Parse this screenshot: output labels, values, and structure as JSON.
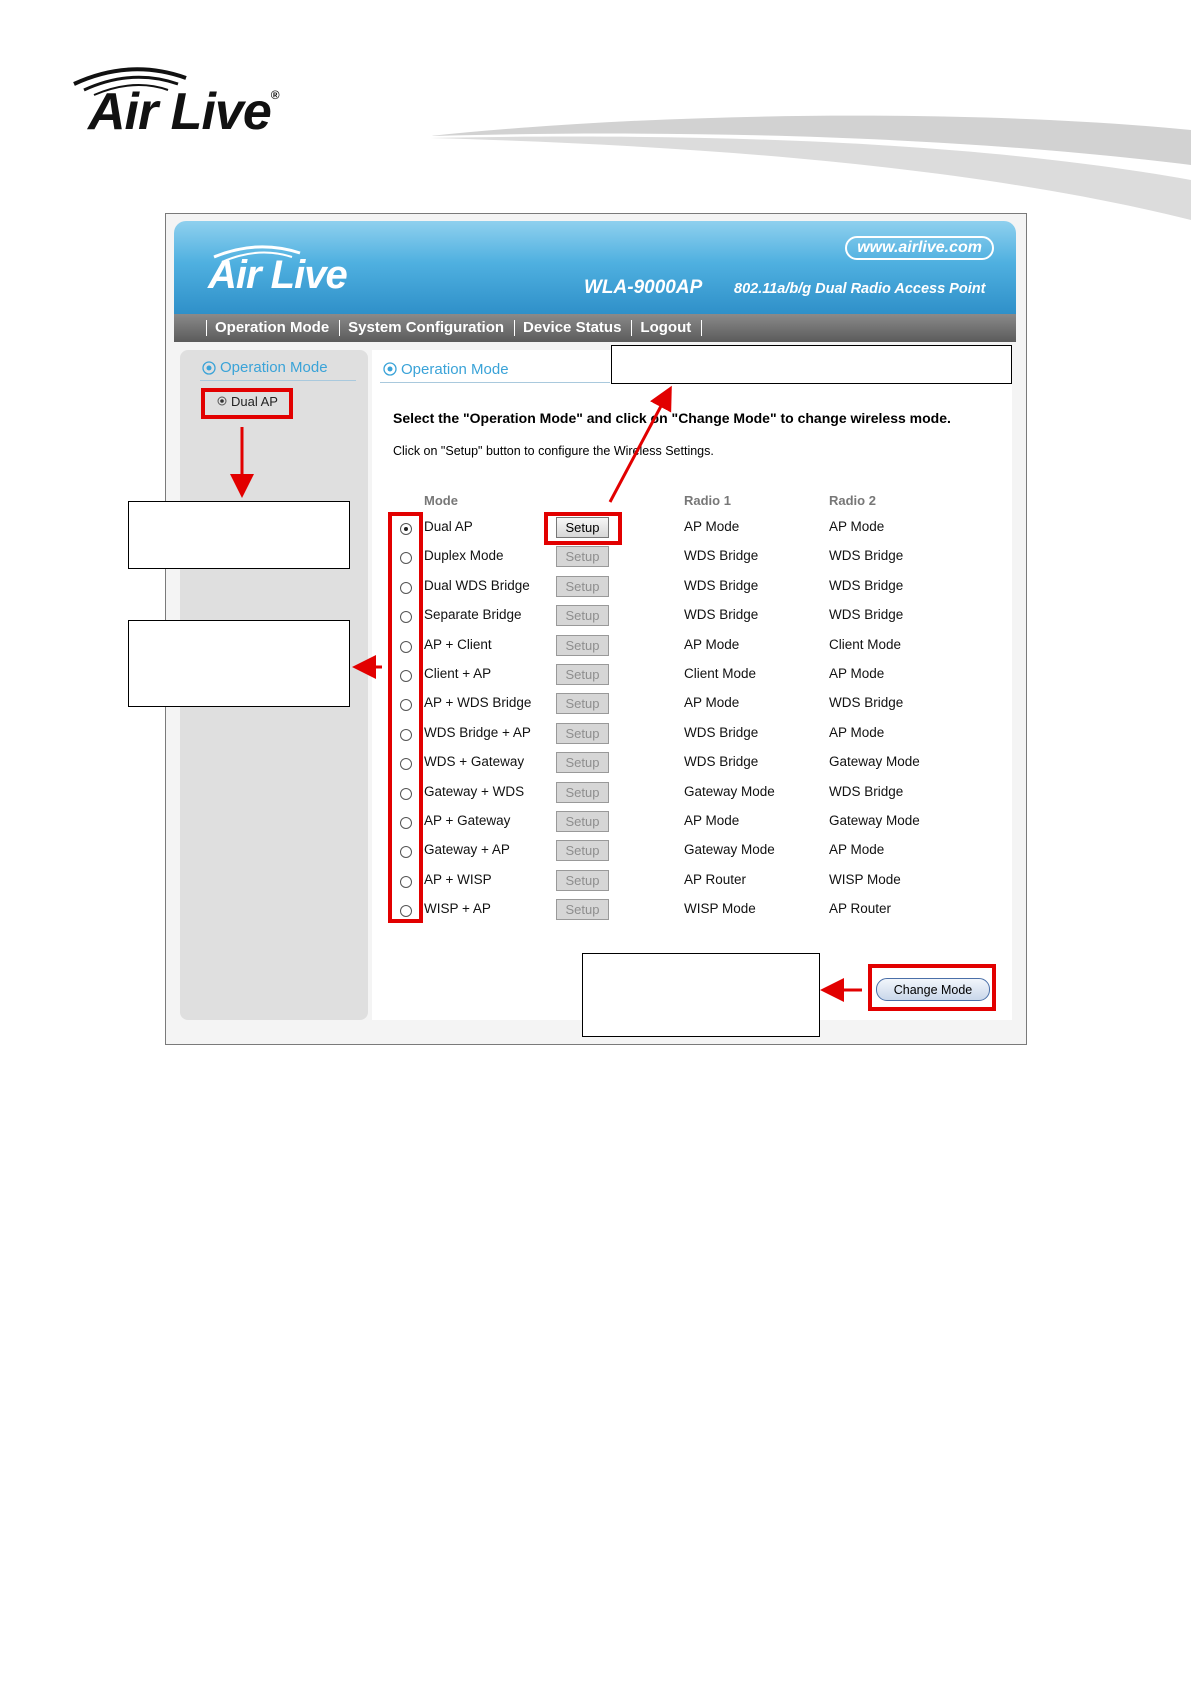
{
  "brand": {
    "name": "Air Live",
    "registered": "®"
  },
  "banner": {
    "url": "www.airlive.com",
    "model": "WLA-9000AP",
    "description": "802.11a/b/g Dual Radio Access Point"
  },
  "nav": [
    "Operation Mode",
    "System Configuration",
    "Device Status",
    "Logout"
  ],
  "sidebar": {
    "title": "Operation Mode",
    "item": "Dual AP"
  },
  "content": {
    "title": "Operation Mode",
    "heading": "Select the \"Operation Mode\" and click on \"Change Mode\" to change wireless mode.",
    "subtext": "Click on \"Setup\" button to configure the Wireless Settings.",
    "columns": {
      "mode": "Mode",
      "radio1": "Radio 1",
      "radio2": "Radio 2"
    },
    "setup_label": "Setup",
    "rows": [
      {
        "mode": "Dual AP",
        "radio1": "AP Mode",
        "radio2": "AP Mode",
        "selected": true
      },
      {
        "mode": "Duplex Mode",
        "radio1": "WDS Bridge",
        "radio2": "WDS Bridge"
      },
      {
        "mode": "Dual WDS Bridge",
        "radio1": "WDS Bridge",
        "radio2": "WDS Bridge"
      },
      {
        "mode": "Separate Bridge",
        "radio1": "WDS Bridge",
        "radio2": "WDS Bridge"
      },
      {
        "mode": "AP + Client",
        "radio1": "AP Mode",
        "radio2": "Client Mode"
      },
      {
        "mode": "Client + AP",
        "radio1": "Client Mode",
        "radio2": "AP Mode"
      },
      {
        "mode": "AP + WDS Bridge",
        "radio1": "AP Mode",
        "radio2": "WDS Bridge"
      },
      {
        "mode": "WDS Bridge + AP",
        "radio1": "WDS Bridge",
        "radio2": "AP Mode"
      },
      {
        "mode": "WDS + Gateway",
        "radio1": "WDS Bridge",
        "radio2": "Gateway Mode"
      },
      {
        "mode": "Gateway +  WDS",
        "radio1": "Gateway Mode",
        "radio2": "WDS Bridge"
      },
      {
        "mode": "AP + Gateway",
        "radio1": "AP Mode",
        "radio2": "Gateway Mode"
      },
      {
        "mode": "Gateway  + AP",
        "radio1": "Gateway Mode",
        "radio2": "AP Mode"
      },
      {
        "mode": "AP + WISP",
        "radio1": "AP Router",
        "radio2": "WISP Mode"
      },
      {
        "mode": "WISP + AP",
        "radio1": "WISP Mode",
        "radio2": "AP Router"
      }
    ],
    "change_mode": "Change Mode"
  },
  "colors": {
    "annotation_red": "#e20000",
    "banner_blue": "#2f90c9",
    "link_blue": "#3aa3d8"
  }
}
